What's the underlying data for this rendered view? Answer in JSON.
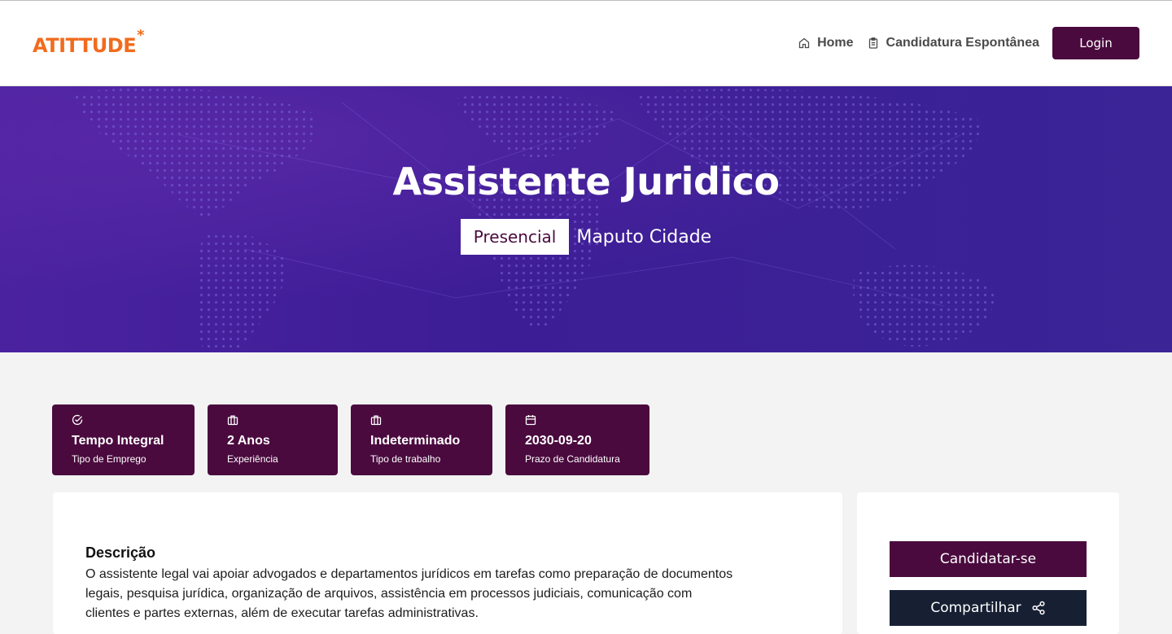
{
  "header": {
    "logo_text": "ATITTUDE",
    "logo_star": "*",
    "nav": [
      {
        "label": "Home",
        "icon": "home-icon"
      },
      {
        "label": "Candidatura Espontânea",
        "icon": "clipboard-icon"
      }
    ],
    "login_label": "Login"
  },
  "hero": {
    "title": "Assistente Juridico",
    "work_mode": "Presencial",
    "location": "Maputo Cidade"
  },
  "cards": [
    {
      "icon": "check-circle-icon",
      "value": "Tempo Integral",
      "label": "Tipo de Emprego"
    },
    {
      "icon": "briefcase-icon",
      "value": "2 Anos",
      "label": "Experiência"
    },
    {
      "icon": "briefcase-icon",
      "value": "Indeterminado",
      "label": "Tipo de trabalho"
    },
    {
      "icon": "calendar-icon",
      "value": "2030-09-20",
      "label": "Prazo de Candidatura"
    }
  ],
  "description": {
    "title": "Descrição",
    "text": "O assistente legal vai apoiar advogados e departamentos jurídicos em tarefas como preparação de documentos legais, pesquisa jurídica, organização de arquivos, assistência em processos judiciais, comunicação com clientes e partes externas, além de executar tarefas administrativas."
  },
  "actions": {
    "apply_label": "Candidatar-se",
    "share_label": "Compartilhar",
    "share_icon": "share-icon"
  },
  "colors": {
    "brand_orange": "#f26b1d",
    "primary_plum": "#4a0a3e",
    "hero_purple": "#3c1d95",
    "dark_navy": "#172033"
  }
}
